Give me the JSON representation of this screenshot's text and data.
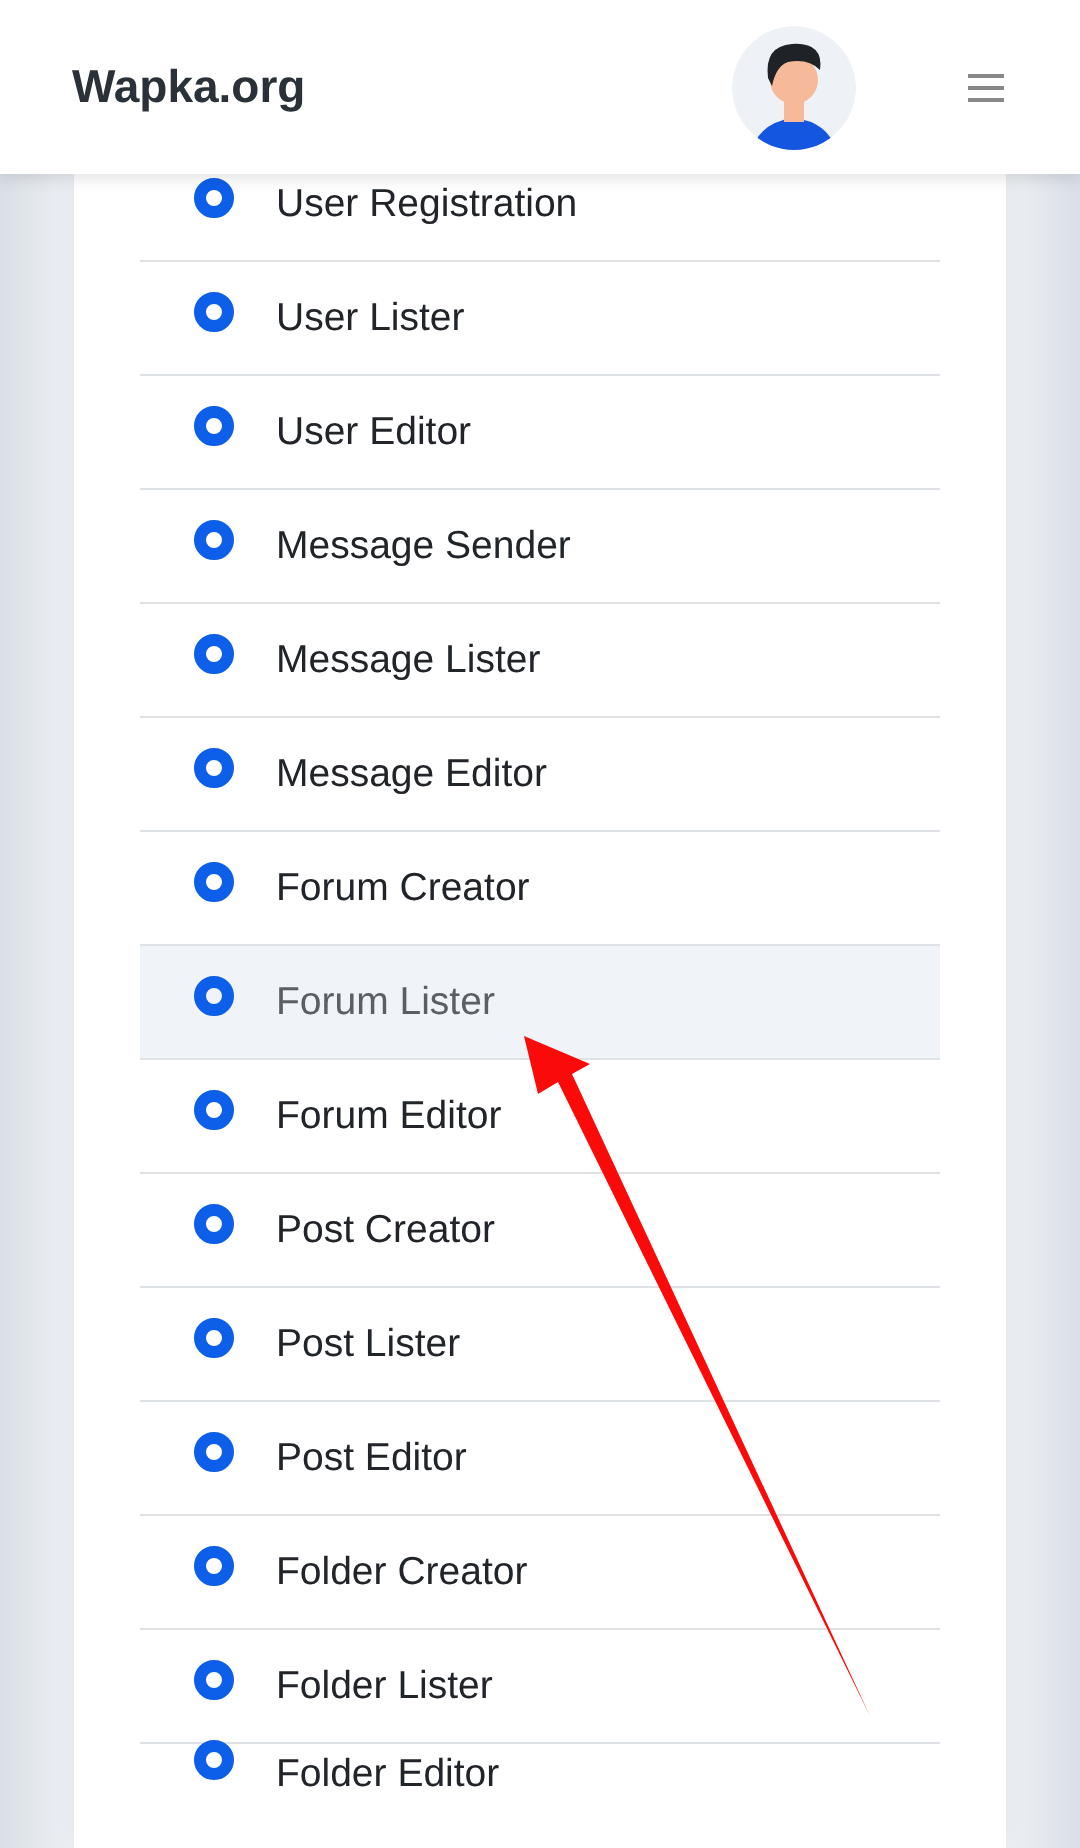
{
  "header": {
    "brand": "Wapka.org"
  },
  "items": [
    {
      "label": "User Registration",
      "selected": false
    },
    {
      "label": "User Lister",
      "selected": false
    },
    {
      "label": "User Editor",
      "selected": false
    },
    {
      "label": "Message Sender",
      "selected": false
    },
    {
      "label": "Message Lister",
      "selected": false
    },
    {
      "label": "Message Editor",
      "selected": false
    },
    {
      "label": "Forum Creator",
      "selected": false
    },
    {
      "label": "Forum Lister",
      "selected": true
    },
    {
      "label": "Forum Editor",
      "selected": false
    },
    {
      "label": "Post Creator",
      "selected": false
    },
    {
      "label": "Post Lister",
      "selected": false
    },
    {
      "label": "Post Editor",
      "selected": false
    },
    {
      "label": "Folder Creator",
      "selected": false
    },
    {
      "label": "Folder Lister",
      "selected": false
    },
    {
      "label": "Folder Editor",
      "selected": false
    }
  ],
  "annotation": {
    "kind": "arrow"
  }
}
